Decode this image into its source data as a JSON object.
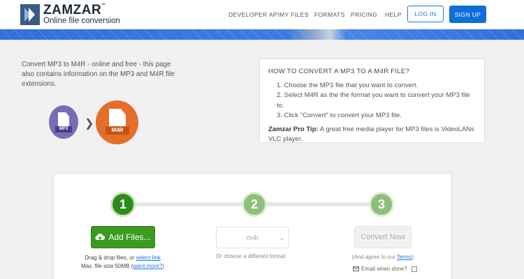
{
  "header": {
    "logo_name": "ZAMZAR",
    "logo_tm": "™",
    "logo_sub": "Online file conversion",
    "nav": [
      {
        "label": "DEVELOPER API"
      },
      {
        "label": "MY FILES"
      },
      {
        "label": "FORMATS"
      },
      {
        "label": "PRICING"
      },
      {
        "label": "HELP"
      }
    ],
    "login_label": "LOG IN",
    "signup_label": "SIGN UP"
  },
  "intro": {
    "text": "Convert MP3 to M4R - online and free - this page also contains information on the MP3 and M4R file extensions."
  },
  "conversion": {
    "from_label": "MP3",
    "to_label": "M4R",
    "from_color": "#7b6bb5",
    "to_color": "#e56e2a"
  },
  "howto": {
    "title": "HOW TO CONVERT A MP3 TO A M4R FILE?",
    "steps": [
      "1. Choose the MP3 file that you want to convert.",
      "2. Select M4R as the the format you want to convert your MP3 file to.",
      "3. Click \"Convert\" to convert your MP3 file."
    ],
    "tip_label": "Zamzar Pro Tip:",
    "tip_text": " A great free media player for MP3 files is VideoLANs VLC player."
  },
  "converter": {
    "step_numbers": [
      "1",
      "2",
      "3"
    ],
    "add_files_label": "Add Files...",
    "drag_text": "Drag & drop files, or ",
    "select_link": "select link",
    "max_size_text": "Max. file size 50MB (",
    "want_more_link": "want more?",
    "max_size_close": ")",
    "format_value": "m4r",
    "choose_format_text": "Or choose a different format",
    "convert_label": "Convert Now",
    "agree_text": "(And agree to our ",
    "terms_link": "Terms",
    "agree_close": ")",
    "email_label": "Email when done?"
  },
  "colors": {
    "primary_blue": "#0e6fd8",
    "green": "#3c9a23"
  }
}
